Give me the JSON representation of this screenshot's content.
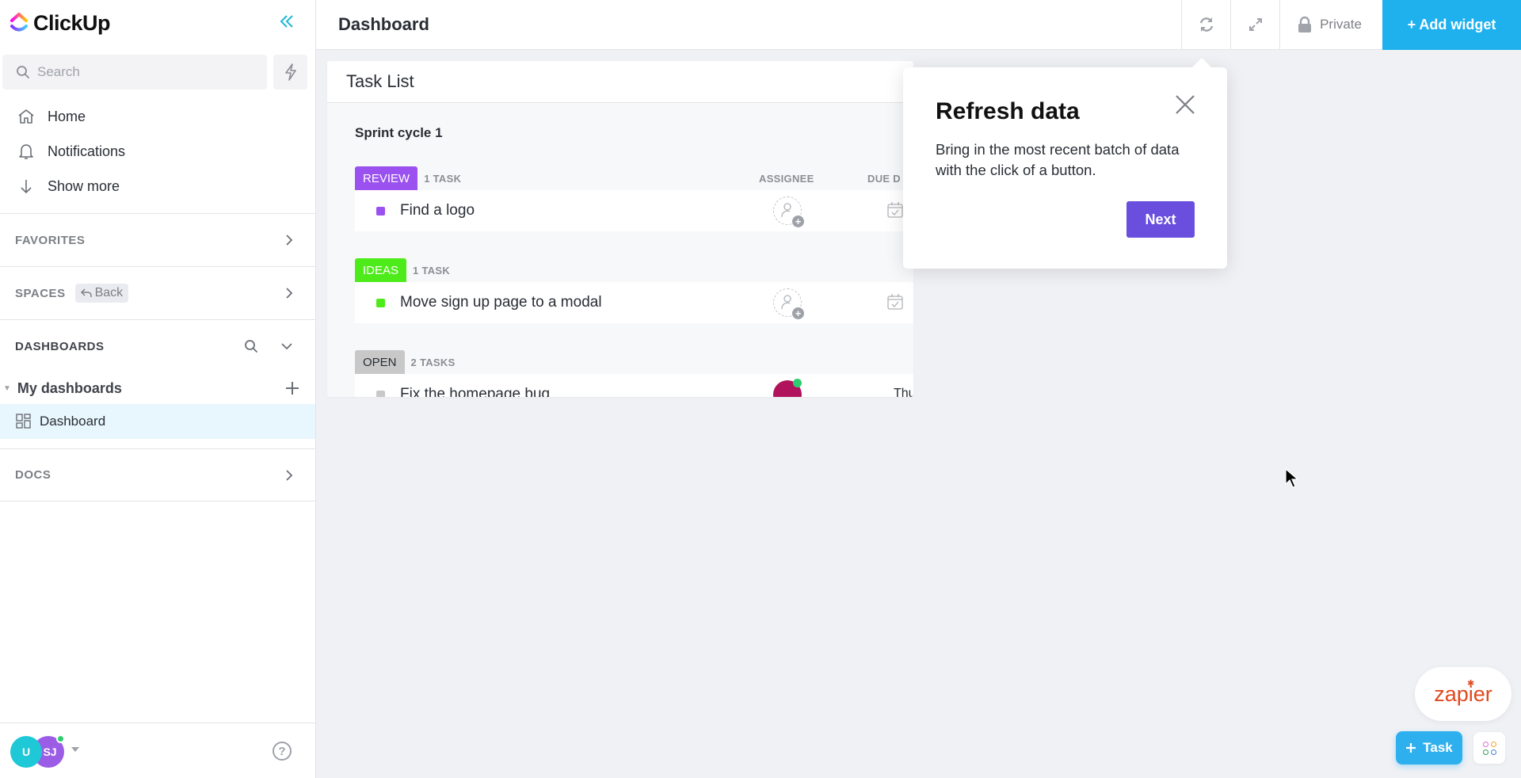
{
  "app": {
    "name": "ClickUp"
  },
  "sidebar": {
    "search_placeholder": "Search",
    "nav": [
      {
        "label": "Home",
        "icon": "home-icon"
      },
      {
        "label": "Notifications",
        "icon": "bell-icon"
      },
      {
        "label": "Show more",
        "icon": "arrow-down-icon"
      }
    ],
    "favorites_label": "FAVORITES",
    "spaces_label": "SPACES",
    "back_label": "Back",
    "dashboards_label": "DASHBOARDS",
    "my_dashboards_label": "My dashboards",
    "dashboard_item": "Dashboard",
    "docs_label": "DOCS",
    "avatars": [
      {
        "initials": "U",
        "color": "#1ec8d6"
      },
      {
        "initials": "SJ",
        "color": "#9b5de5"
      }
    ],
    "help_glyph": "?"
  },
  "header": {
    "title": "Dashboard",
    "privacy_label": "Private",
    "add_widget_label": "+ Add widget"
  },
  "widget": {
    "title": "Task List",
    "list_name": "Sprint cycle 1",
    "columns": {
      "assignee": "ASSIGNEE",
      "due": "DUE D"
    },
    "groups": [
      {
        "status": "REVIEW",
        "color": "#9b51f0",
        "count": "1 TASK",
        "tasks": [
          {
            "name": "Find a logo",
            "assignee": "",
            "due": ""
          }
        ]
      },
      {
        "status": "IDEAS",
        "color": "#4eeb1a",
        "count": "1 TASK",
        "tasks": [
          {
            "name": "Move sign up page to a modal",
            "assignee": "",
            "due": ""
          }
        ]
      },
      {
        "status": "OPEN",
        "color": "#c8c8c8",
        "count": "2 TASKS",
        "tasks": [
          {
            "name": "Fix the homepage bug",
            "assignee": "avatar",
            "due": "Thu"
          }
        ]
      }
    ]
  },
  "popover": {
    "title": "Refresh data",
    "body": "Bring in the most recent batch of data with the click of a button.",
    "next_label": "Next"
  },
  "floating": {
    "zapier_label": "zapier",
    "task_label": "Task"
  },
  "colors": {
    "accent": "#1fb0ee",
    "primary_button": "#6a4ede",
    "selected_bg": "#e8f6fd"
  }
}
